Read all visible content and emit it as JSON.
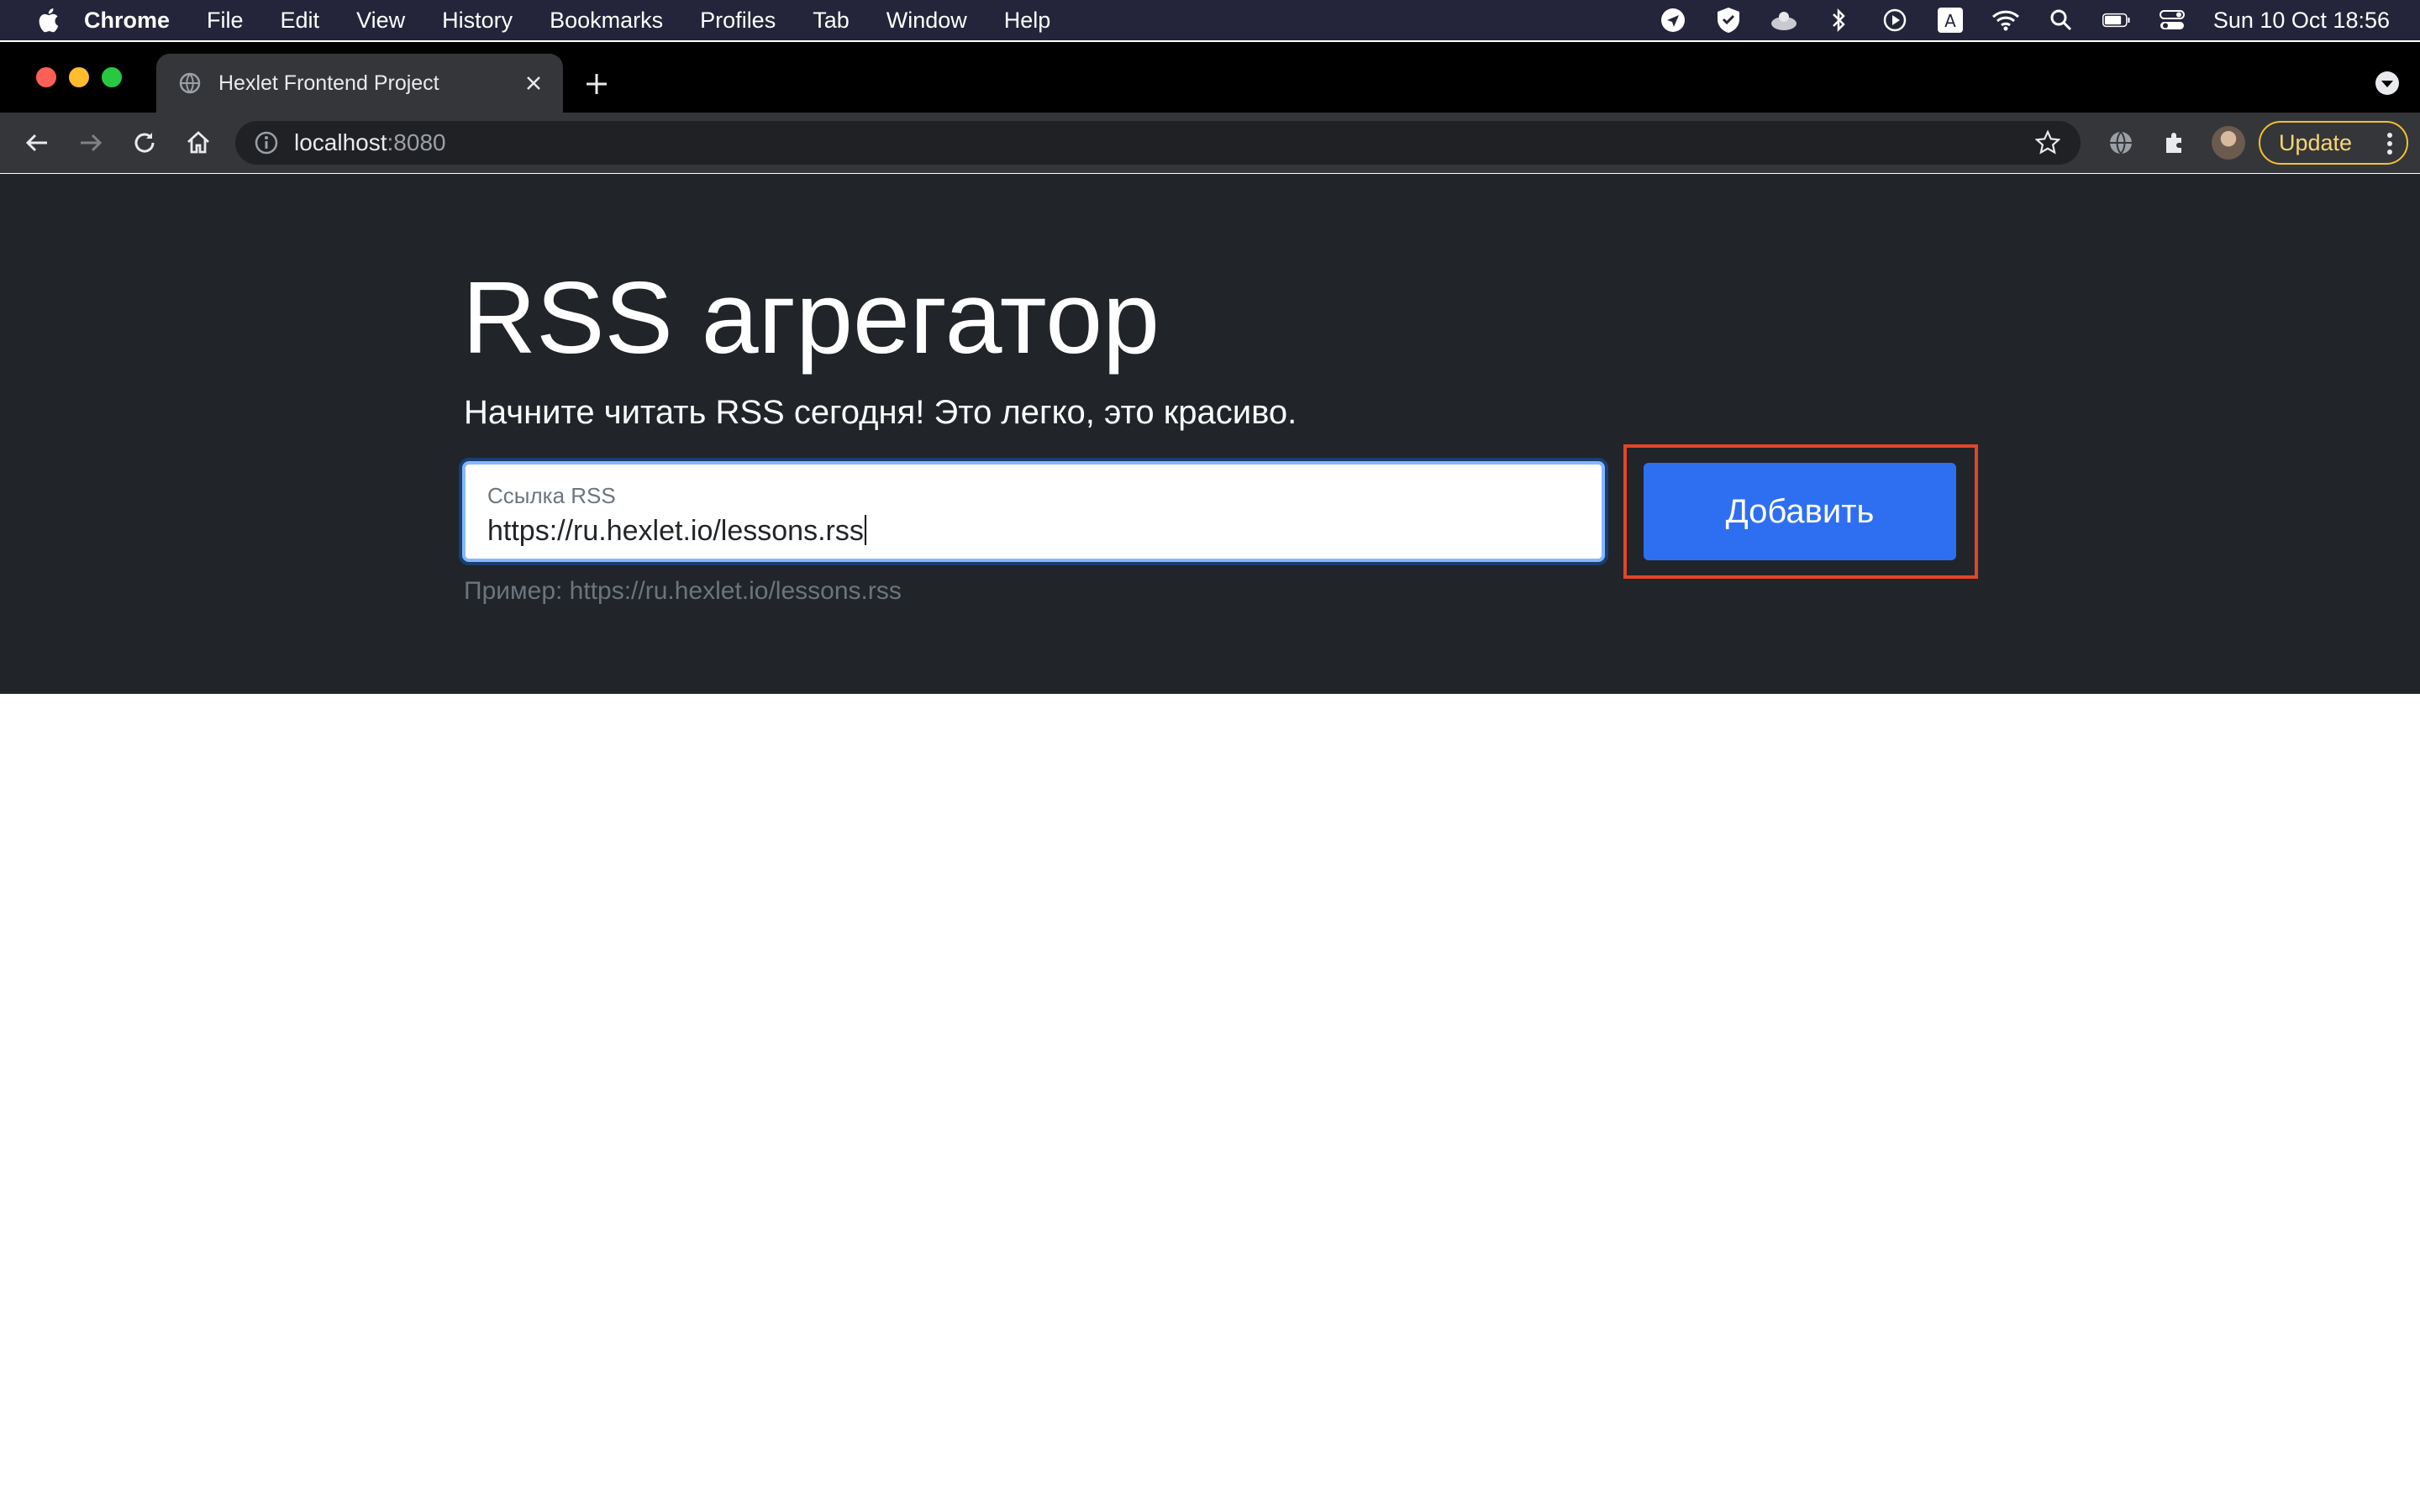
{
  "menubar": {
    "app_name": "Chrome",
    "items": [
      "File",
      "Edit",
      "View",
      "History",
      "Bookmarks",
      "Profiles",
      "Tab",
      "Window",
      "Help"
    ],
    "status_icons": [
      "location-icon",
      "shield-icon",
      "cloud-icon",
      "bluetooth-icon",
      "play-icon",
      "keyboard-input-icon",
      "wifi-icon",
      "spotlight-search-icon",
      "battery-icon",
      "control-center-icon"
    ],
    "clock": "Sun 10 Oct  18:56"
  },
  "browser": {
    "tab_title": "Hexlet Frontend Project",
    "url_host": "localhost",
    "url_port": ":8080",
    "update_label": "Update"
  },
  "page": {
    "title": "RSS агрегатор",
    "lead": "Начните читать RSS сегодня! Это легко, это красиво.",
    "form": {
      "label": "Ссылка RSS",
      "value": "https://ru.hexlet.io/lessons.rss",
      "submit_label": "Добавить"
    },
    "example": "Пример: https://ru.hexlet.io/lessons.rss"
  },
  "colors": {
    "hero_bg": "#212529",
    "primary": "#2e6ff2",
    "highlight_border": "#e2452b",
    "update_border": "#f1c232"
  }
}
